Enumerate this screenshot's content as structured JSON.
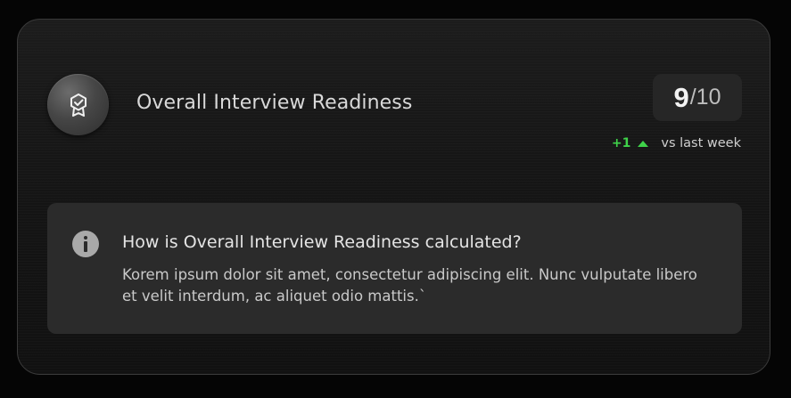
{
  "card": {
    "title": "Overall Interview Readiness",
    "badge_icon": "award-ribbon-icon",
    "score": {
      "value": "9",
      "max": "/10"
    },
    "trend": {
      "delta": "+1",
      "direction_icon": "triangle-up-icon",
      "label": "vs last week",
      "color": "#3fd34a"
    }
  },
  "info": {
    "icon": "info-icon",
    "title": "How is Overall Interview Readiness calculated?",
    "body": "Korem ipsum dolor sit amet, consectetur adipiscing elit. Nunc vulputate libero et velit interdum, ac aliquet odio mattis.`"
  }
}
